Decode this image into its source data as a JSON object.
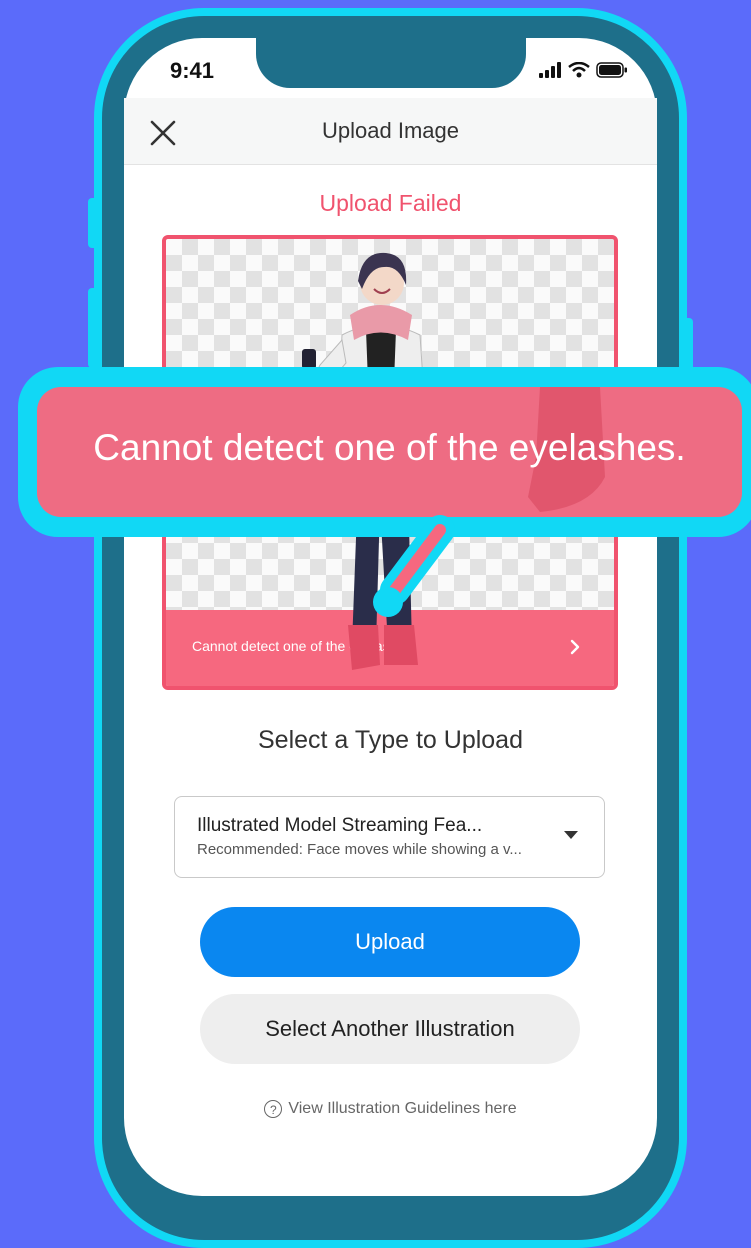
{
  "status_bar": {
    "time": "9:41"
  },
  "header": {
    "title": "Upload Image"
  },
  "upload_status": {
    "title": "Upload Failed"
  },
  "preview": {
    "banner_message": "Cannot detect one of the eyelashes."
  },
  "callout": {
    "message": "Cannot detect one of the eyelashes."
  },
  "type_section": {
    "heading": "Select a Type to Upload"
  },
  "type_select": {
    "selected_label": "Illustrated Model Streaming Fea...",
    "selected_description": "Recommended: Face moves while showing a v..."
  },
  "actions": {
    "upload_label": "Upload",
    "select_another_label": "Select Another Illustration"
  },
  "help_link": {
    "icon_glyph": "?",
    "label": "View Illustration Guidelines here"
  },
  "colors": {
    "background": "#5b6bfa",
    "phone_frame": "#11d8f5",
    "error": "#f0536e",
    "primary_button": "#0a87f0"
  }
}
